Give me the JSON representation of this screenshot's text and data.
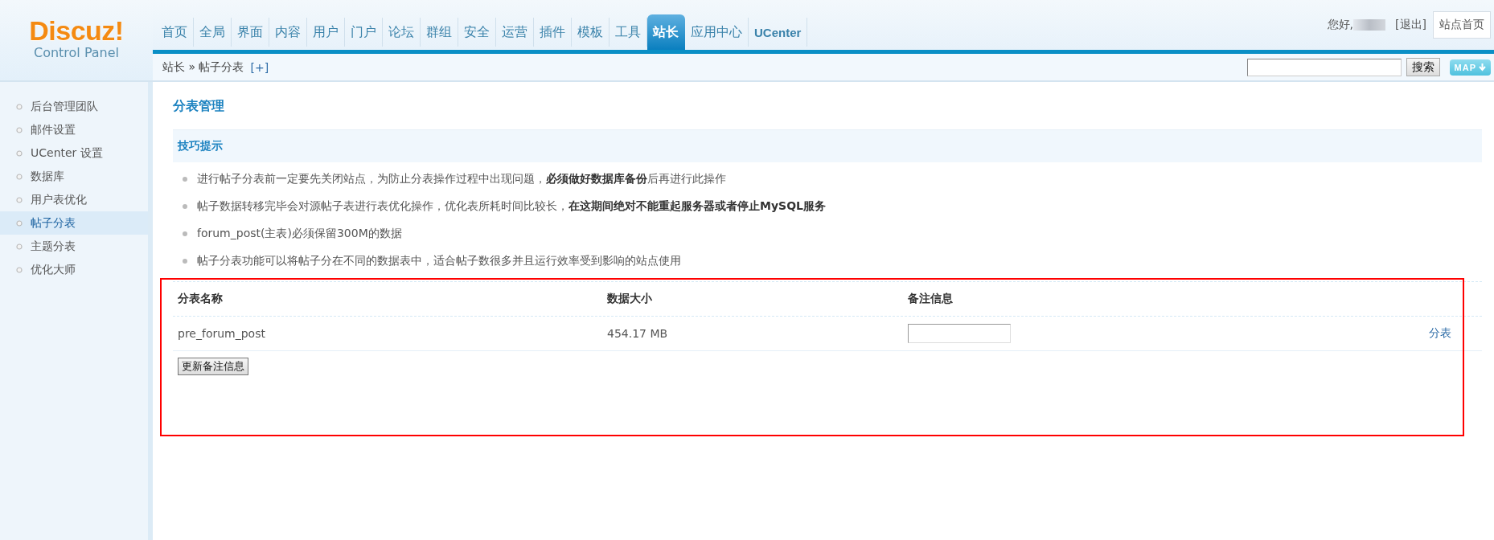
{
  "header": {
    "logo": {
      "title": "Discuz!",
      "subtitle": "Control Panel"
    },
    "nav": [
      {
        "label": "首页",
        "selected": false
      },
      {
        "label": "全局",
        "selected": false
      },
      {
        "label": "界面",
        "selected": false
      },
      {
        "label": "内容",
        "selected": false
      },
      {
        "label": "用户",
        "selected": false
      },
      {
        "label": "门户",
        "selected": false
      },
      {
        "label": "论坛",
        "selected": false
      },
      {
        "label": "群组",
        "selected": false
      },
      {
        "label": "安全",
        "selected": false
      },
      {
        "label": "运营",
        "selected": false
      },
      {
        "label": "插件",
        "selected": false
      },
      {
        "label": "模板",
        "selected": false
      },
      {
        "label": "工具",
        "selected": false
      },
      {
        "label": "站长",
        "selected": true
      },
      {
        "label": "应用中心",
        "selected": false
      },
      {
        "label": "UCenter",
        "selected": false
      }
    ],
    "greeting": "您好,",
    "logout": "[退出]",
    "site_home": "站点首页"
  },
  "breadcrumb": {
    "items": [
      "站长",
      "帖子分表"
    ],
    "separator": "»",
    "add": "[+]"
  },
  "search": {
    "button": "搜索",
    "map": "MAP"
  },
  "sidebar": {
    "items": [
      {
        "label": "后台管理团队",
        "selected": false
      },
      {
        "label": "邮件设置",
        "selected": false
      },
      {
        "label": "UCenter 设置",
        "selected": false
      },
      {
        "label": "数据库",
        "selected": false
      },
      {
        "label": "用户表优化",
        "selected": false
      },
      {
        "label": "帖子分表",
        "selected": true
      },
      {
        "label": "主题分表",
        "selected": false
      },
      {
        "label": "优化大师",
        "selected": false
      }
    ]
  },
  "page_title": "分表管理",
  "tips": {
    "title": "技巧提示",
    "items": [
      "进行帖子分表前一定要先关闭站点，为防止分表操作过程中出现问题，**必须做好数据库备份**后再进行此操作",
      "帖子数据转移完毕会对源帖子表进行表优化操作，优化表所耗时间比较长，**在这期间绝对不能重起服务器或者停止MySQL服务**",
      "forum_post(主表)必须保留300M的数据",
      "帖子分表功能可以将帖子分在不同的数据表中，适合帖子数很多并且运行效率受到影响的站点使用"
    ]
  },
  "table": {
    "columns": [
      "分表名称",
      "数据大小",
      "备注信息"
    ],
    "rows": [
      {
        "name": "pre_forum_post",
        "size": "454.17 MB",
        "action": "分表"
      }
    ],
    "submit": "更新备注信息"
  }
}
